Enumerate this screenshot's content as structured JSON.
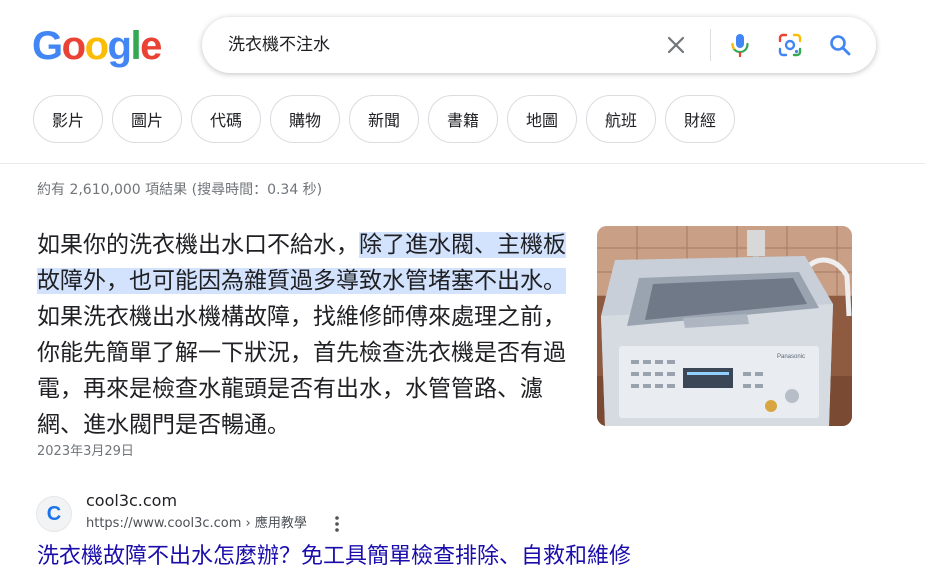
{
  "logo": {
    "letters": [
      "G",
      "o",
      "o",
      "g",
      "l",
      "e"
    ],
    "colors": [
      "#4285f4",
      "#ea4335",
      "#fbbc05",
      "#4285f4",
      "#34a853",
      "#ea4335"
    ]
  },
  "search": {
    "query": "洗衣機不注水",
    "icons": [
      "close-icon",
      "mic-icon",
      "lens-icon",
      "search-icon"
    ]
  },
  "chips": [
    "影片",
    "圖片",
    "代碼",
    "購物",
    "新聞",
    "書籍",
    "地圖",
    "航班",
    "財經"
  ],
  "stats": "約有 2,610,000 項結果 (搜尋時間：0.34 秒)",
  "snippet": {
    "text_before": "如果你的洗衣機出水口不給水，",
    "text_highlight": "除了進水閥、主機板故障外，也可能因為雜質過多導致水管堵塞不出水。",
    "text_after": " 如果洗衣機出水機構故障，找維修師傅來處理之前，你能先簡單了解一下狀況，首先檢查洗衣機是否有過電，再來是檢查水龍頭是否有出水，水管管路、濾網、進水閥門是否暢通。",
    "date": "2023年3月29日",
    "image_brand": "Panasonic"
  },
  "result": {
    "favicon_letter": "C",
    "site_name": "cool3c.com",
    "url": "https://www.cool3c.com › 應用教學",
    "title": "洗衣機故障不出水怎麼辦？免工具簡單檢查排除、自救和維修"
  },
  "colors": {
    "link": "#1a0dab",
    "highlight": "#d3e3fd",
    "muted": "#70757a"
  }
}
